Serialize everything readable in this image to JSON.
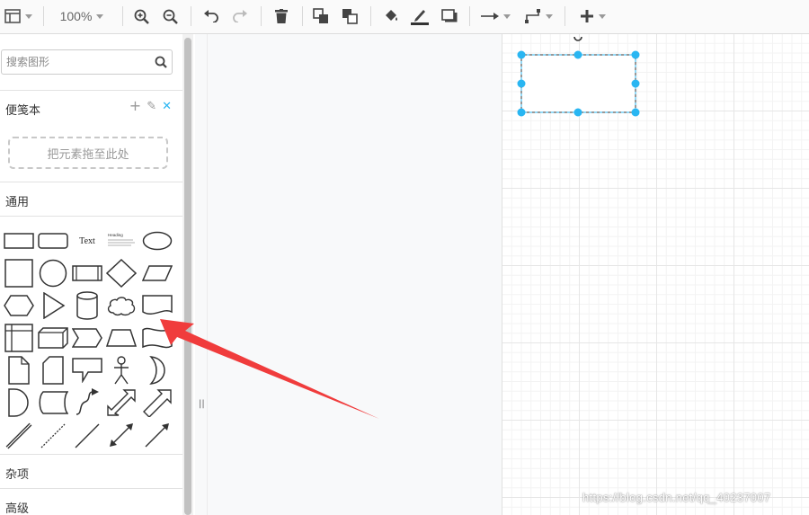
{
  "toolbar": {
    "zoom_label": "100%",
    "items": [
      "format-panel",
      "zoom-in",
      "zoom-out",
      "undo",
      "redo",
      "delete",
      "to-front",
      "to-back",
      "fill-color",
      "line-color",
      "shadow",
      "connection-style",
      "waypoints",
      "insert"
    ]
  },
  "sidebar": {
    "search": {
      "placeholder": "搜索图形"
    },
    "scratchpad": {
      "title": "便笺本",
      "actions": [
        "+",
        "✎",
        "✕"
      ],
      "dropzone_label": "把元素拖至此处"
    },
    "general": {
      "title": "通用"
    },
    "misc": {
      "title": "杂项"
    },
    "advanced": {
      "title": "高级"
    },
    "shape_labels": {
      "text": "Text",
      "heading": "Heading"
    }
  },
  "canvas": {
    "selection_color": "#29b6f2",
    "annotation_arrow_color": "#f03c3c"
  },
  "watermark": "https://blog.csdn.net/qq_40237007",
  "colors": {
    "accent": "#29b6f2",
    "grid": "#e6e6e6",
    "toolbar_bg": "#fafafa"
  }
}
